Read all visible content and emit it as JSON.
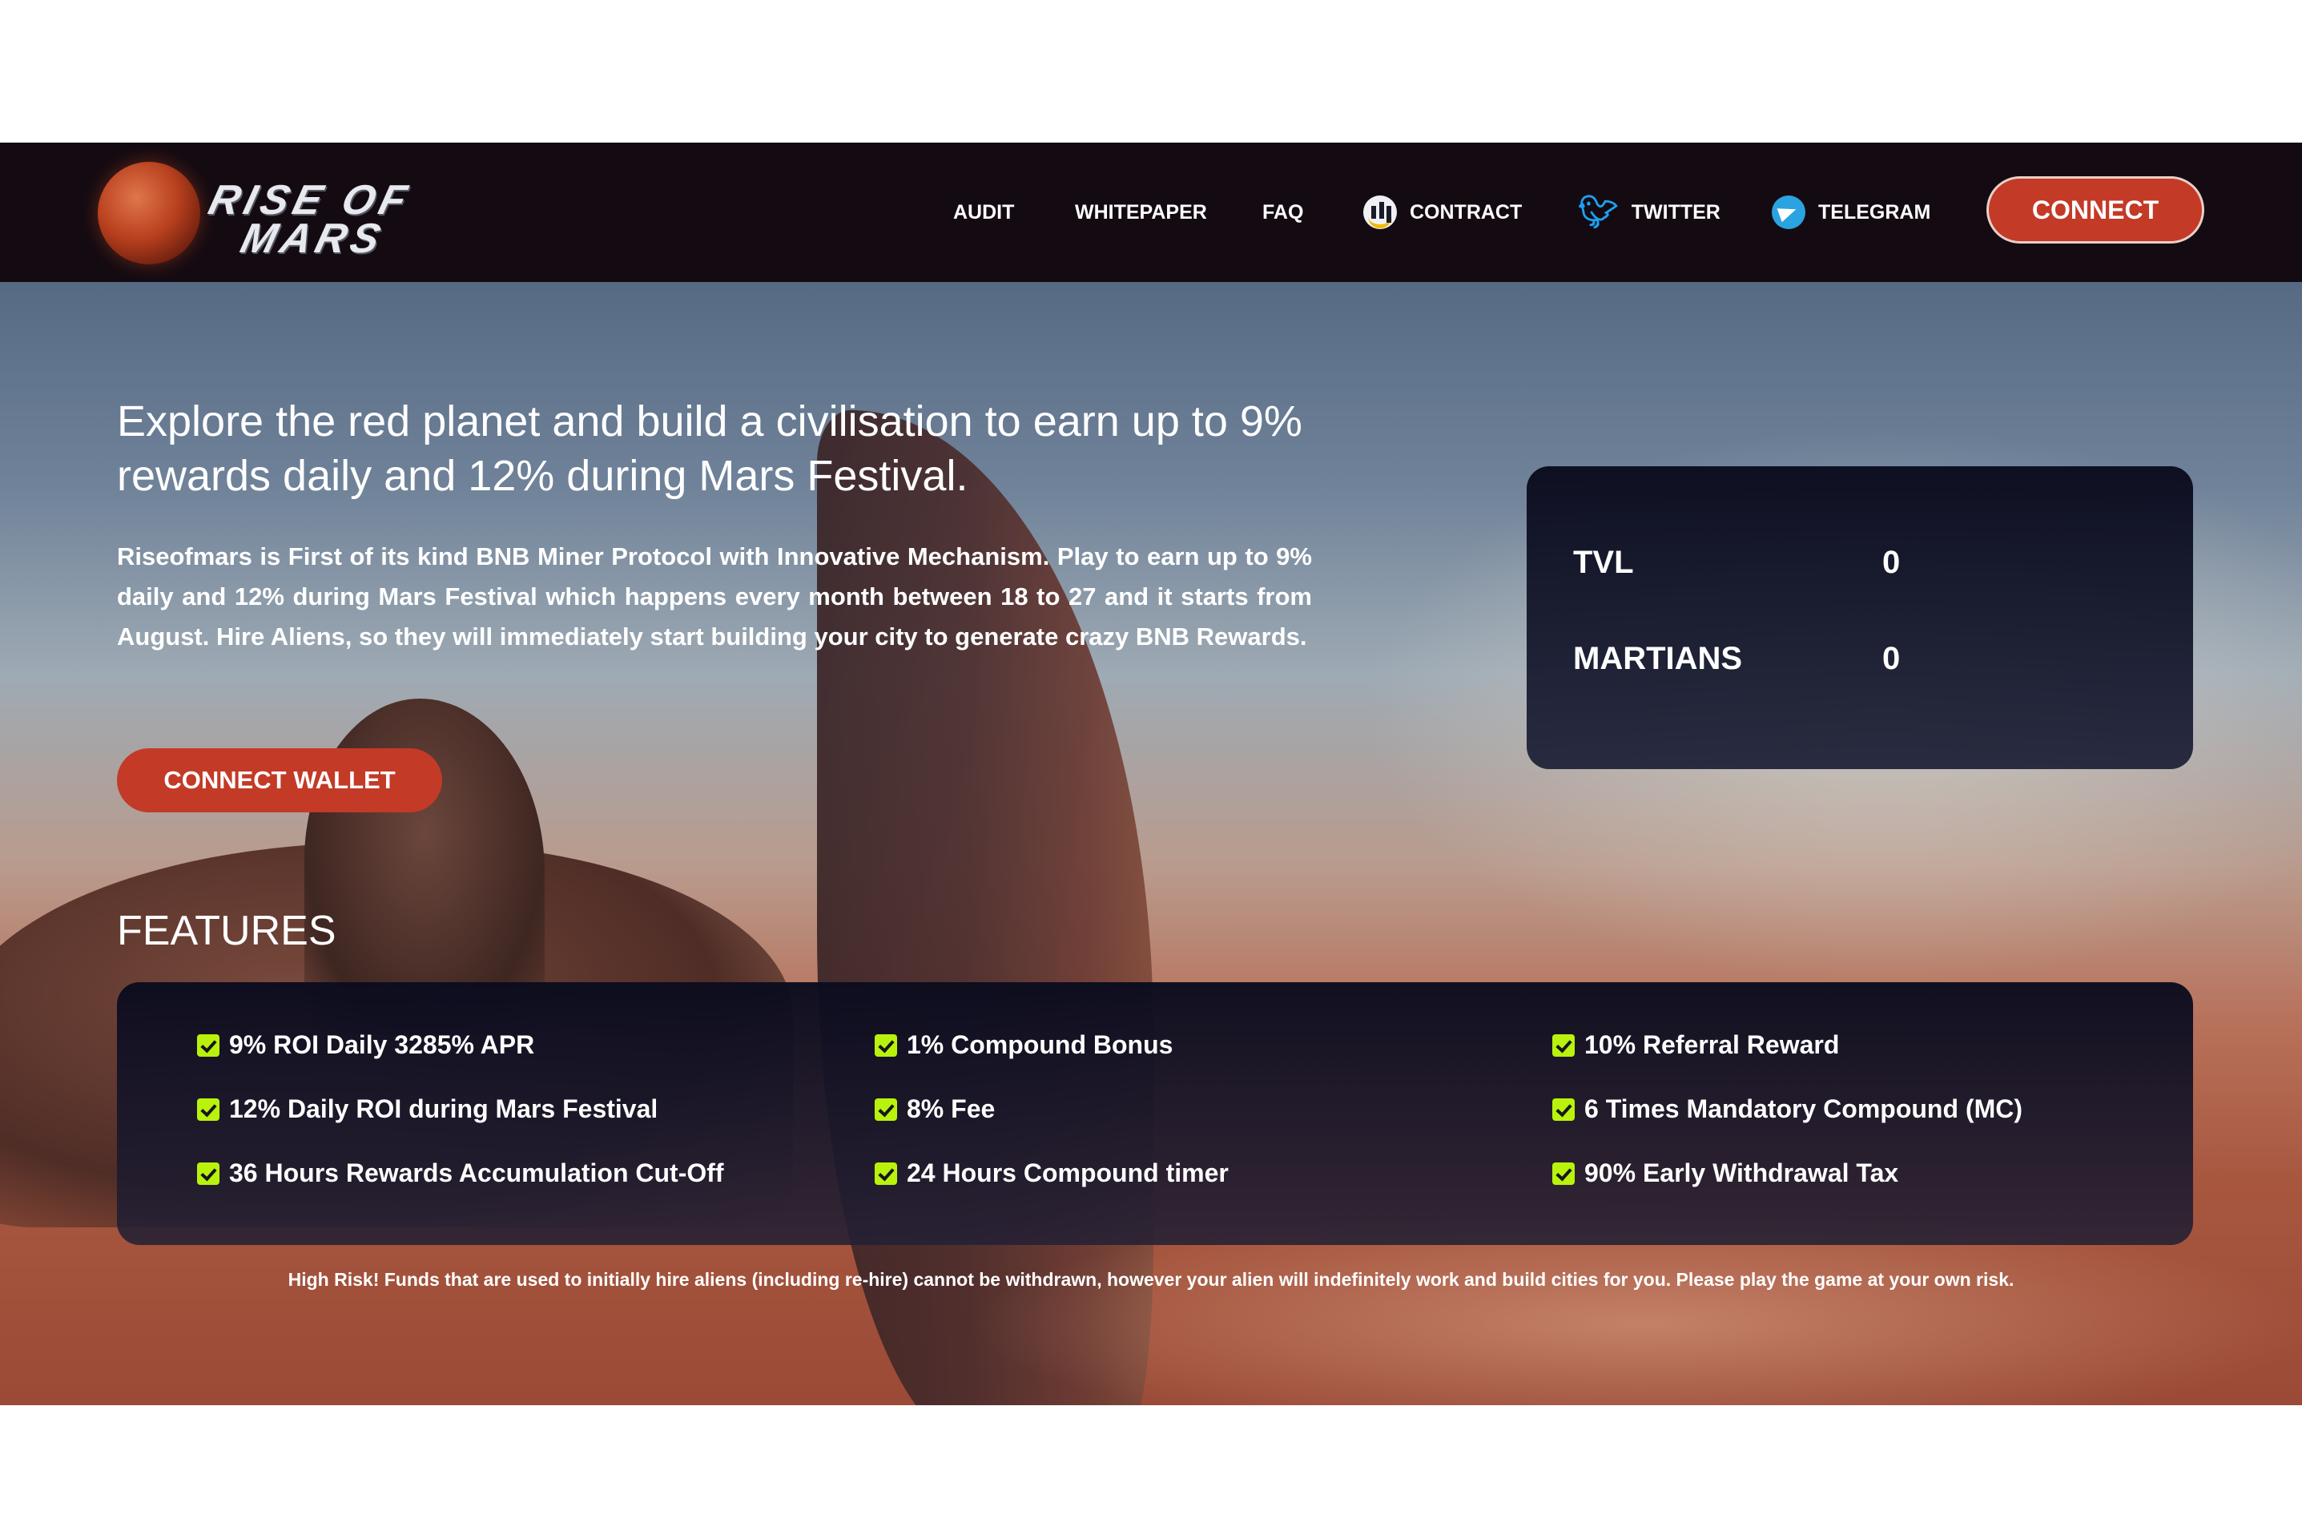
{
  "brand": {
    "logo_line1": "RISE OF",
    "logo_line2": "MARS"
  },
  "nav": {
    "audit": "AUDIT",
    "whitepaper": "WHITEPAPER",
    "faq": "FAQ",
    "contract": "CONTRACT",
    "twitter": "TWITTER",
    "telegram": "TELEGRAM",
    "connect": "CONNECT"
  },
  "hero": {
    "title": "Explore the red planet and build a civilisation to earn up to 9% rewards daily and 12% during Mars Festival.",
    "description": "Riseofmars is First of its kind BNB Miner Protocol with Innovative Mechanism. Play to earn up to 9% daily and 12% during Mars Festival which happens every month between 18 to 27 and it starts from August. Hire Aliens, so they will immediately start building your city to generate crazy BNB Rewards.",
    "connect_wallet": "CONNECT WALLET"
  },
  "stats": {
    "tvl_label": "TVL",
    "tvl_value": "0",
    "martians_label": "MARTIANS",
    "martians_value": "0"
  },
  "features": {
    "title": "FEATURES",
    "col1": [
      "9% ROI Daily 3285% APR",
      "12% Daily ROI during Mars Festival",
      "36 Hours Rewards Accumulation Cut-Off"
    ],
    "col2": [
      "1% Compound Bonus",
      "8% Fee",
      "24 Hours Compound timer"
    ],
    "col3": [
      "10% Referral Reward",
      "6 Times Mandatory Compound (MC)",
      "90% Early Withdrawal Tax"
    ]
  },
  "disclaimer": "High Risk! Funds that are used to initially hire aliens (including re-hire) cannot be withdrawn, however your alien will indefinitely work and build cities for you. Please play the game at your own risk.",
  "colors": {
    "accent": "#c33a27",
    "navbar": "#140b12",
    "check": "#b9f20c",
    "card": "#0b0c1e"
  }
}
